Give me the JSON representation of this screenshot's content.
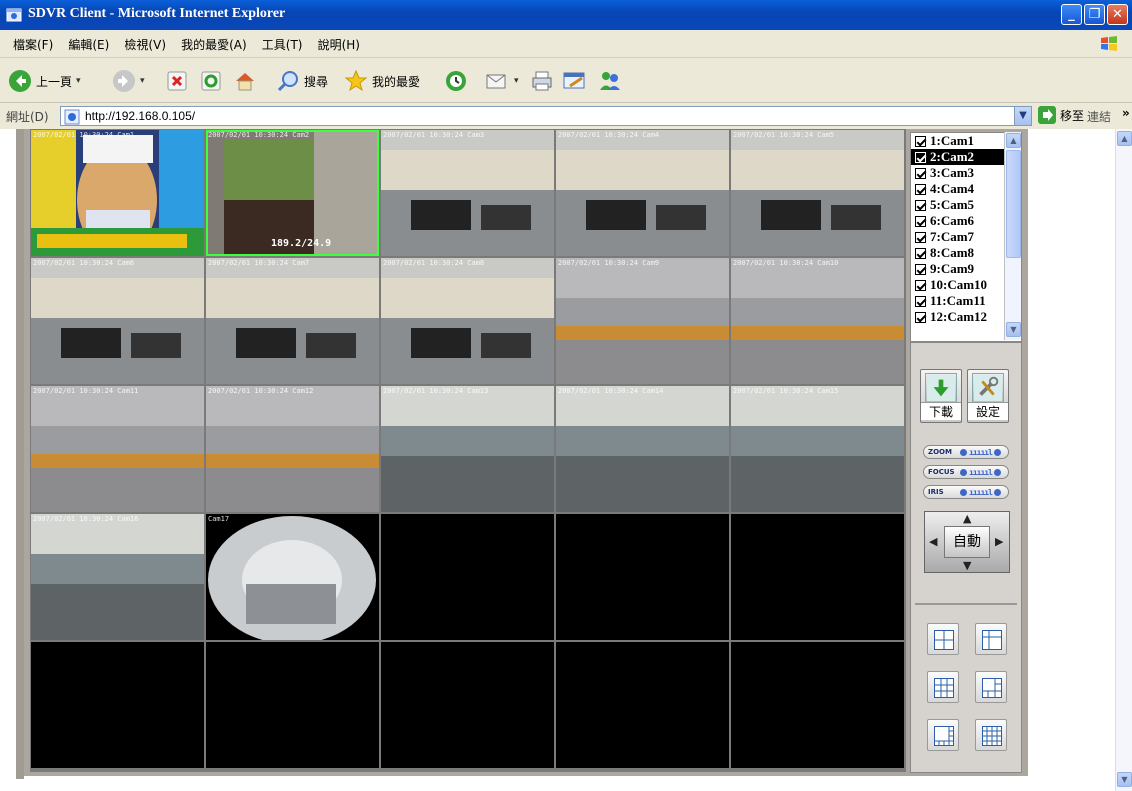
{
  "window": {
    "title": "SDVR Client - Microsoft Internet Explorer",
    "buttons": {
      "minimize": "_",
      "restore": "❐",
      "close": "✕"
    }
  },
  "menu": [
    "檔案(F)",
    "編輯(E)",
    "檢視(V)",
    "我的最愛(A)",
    "工具(T)",
    "說明(H)"
  ],
  "toolbar": {
    "back_label": "上一頁",
    "search_label": "搜尋",
    "favorites_label": "我的最愛",
    "dropdown_mark": "▾"
  },
  "address": {
    "label": "網址(D)",
    "url": "http://192.168.0.105/",
    "go_label": "移至",
    "links_label": "連結",
    "more": "»"
  },
  "camera_grid": {
    "timestamps": [
      "2007/02/01 10:30:24 Cam1",
      "2007/02/01 10:30:24 Cam2",
      "2007/02/01 10:30:24 Cam3",
      "2007/02/01 10:30:24 Cam4",
      "2007/02/01 10:30:24 Cam5",
      "2007/02/01 10:30:24 Cam6",
      "2007/02/01 10:30:24 Cam7",
      "2007/02/01 10:30:24 Cam8",
      "2007/02/01 10:30:24 Cam9",
      "2007/02/01 10:30:24 Cam10",
      "2007/02/01 10:30:24 Cam11",
      "2007/02/01 10:30:24 Cam12",
      "2007/02/01 10:30:24 Cam13",
      "2007/02/01 10:30:24 Cam14",
      "2007/02/01 10:30:24 Cam15",
      "2007/02/01 10:30:24 Cam16",
      "Cam17"
    ],
    "cell2_overlay": "189.2/24.9"
  },
  "camera_list": {
    "items": [
      {
        "label": "1:Cam1",
        "checked": true
      },
      {
        "label": "2:Cam2",
        "checked": true,
        "active": true
      },
      {
        "label": "3:Cam3",
        "checked": true
      },
      {
        "label": "4:Cam4",
        "checked": true
      },
      {
        "label": "5:Cam5",
        "checked": true
      },
      {
        "label": "6:Cam6",
        "checked": true
      },
      {
        "label": "7:Cam7",
        "checked": true
      },
      {
        "label": "8:Cam8",
        "checked": true
      },
      {
        "label": "9:Cam9",
        "checked": true
      },
      {
        "label": "10:Cam10",
        "checked": true
      },
      {
        "label": "11:Cam11",
        "checked": true
      },
      {
        "label": "12:Cam12",
        "checked": true
      }
    ]
  },
  "controls": {
    "download_label": "下載",
    "settings_label": "設定",
    "zoom_label": "ZOOM",
    "focus_label": "FOCUS",
    "iris_label": "IRIS",
    "slider_ticks": "ıııııl",
    "ptz_center_label": "自動",
    "ptz_up": "▲",
    "ptz_down": "▼",
    "ptz_left": "◀",
    "ptz_right": "▶"
  },
  "scroll_arrows": {
    "up": "▲",
    "down": "▼",
    "addr_drop": "▼"
  }
}
